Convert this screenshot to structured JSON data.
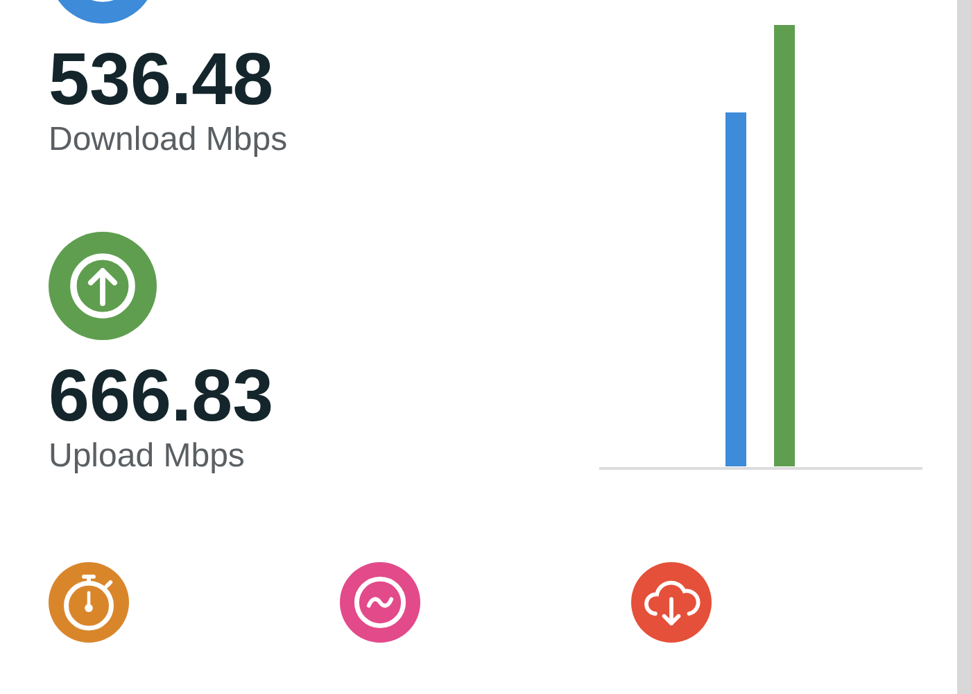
{
  "metrics": [
    {
      "kind": "download",
      "color": "#3d8bd9",
      "value": "536.48",
      "label": "Download Mbps"
    },
    {
      "kind": "upload",
      "color": "#5f9e4f",
      "value": "666.83",
      "label": "Upload Mbps"
    }
  ],
  "stats": [
    {
      "kind": "timer",
      "color": "#d9862b"
    },
    {
      "kind": "wave",
      "color": "#e24a8a"
    },
    {
      "kind": "cloud",
      "color": "#e5503a"
    }
  ]
}
